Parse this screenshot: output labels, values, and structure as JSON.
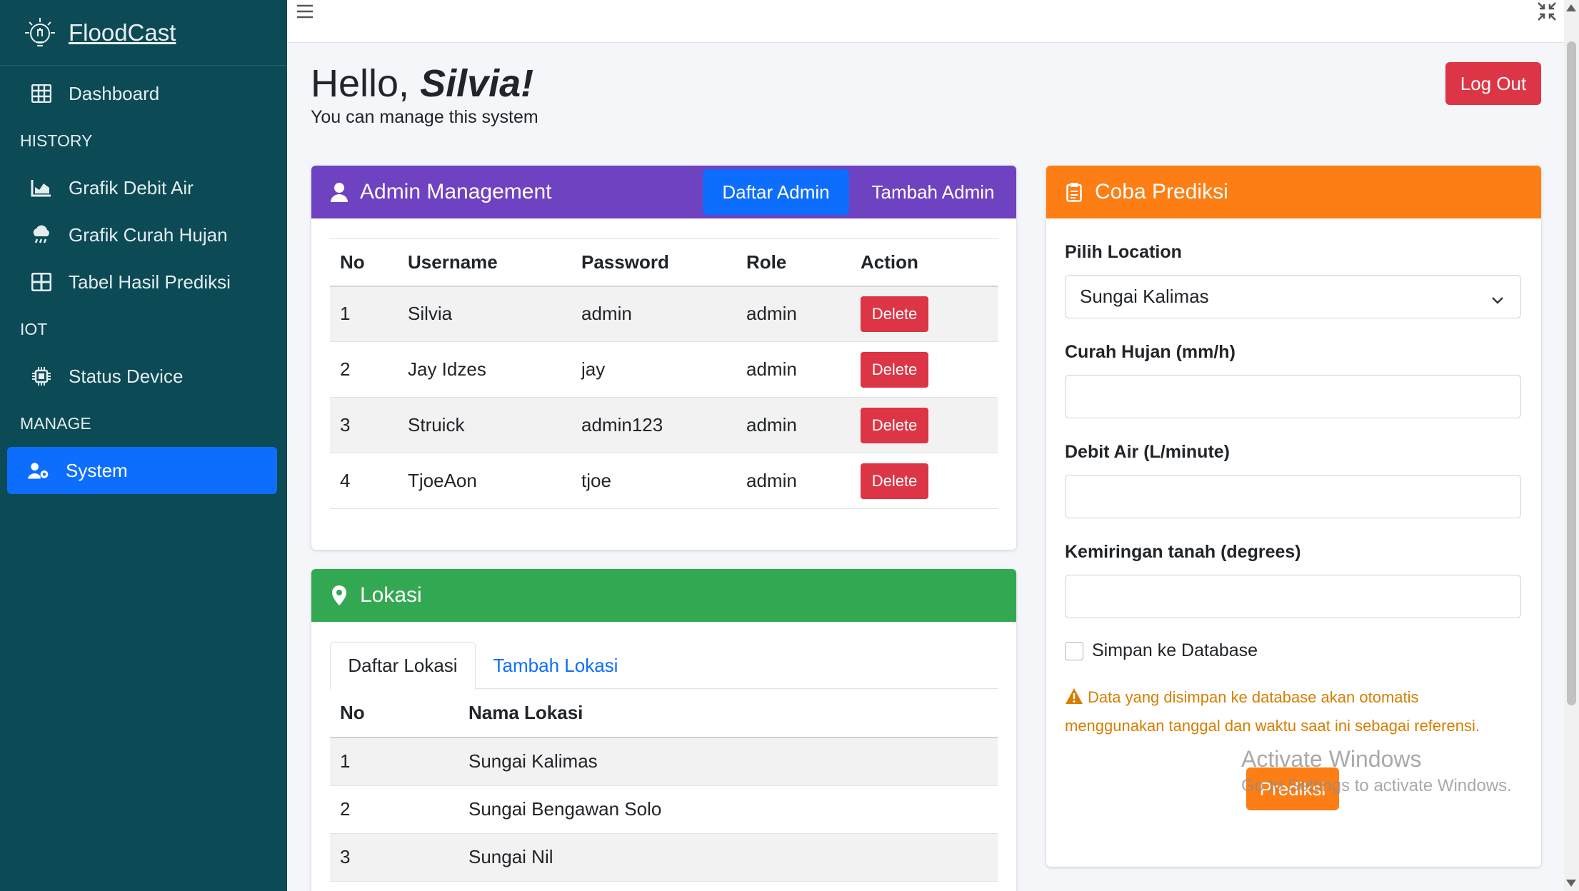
{
  "app": {
    "brand": "FloodCast"
  },
  "sidebar": {
    "items": [
      {
        "label": "Dashboard"
      },
      {
        "header": "HISTORY"
      },
      {
        "label": "Grafik Debit Air"
      },
      {
        "label": "Grafik Curah Hujan"
      },
      {
        "label": "Tabel Hasil Prediksi"
      },
      {
        "header": "IOT"
      },
      {
        "label": "Status Device"
      },
      {
        "header": "MANAGE"
      },
      {
        "label": "System"
      }
    ]
  },
  "greeting": {
    "hello": "Hello, ",
    "name": "Silvia!",
    "subtitle": "You can manage this system"
  },
  "logout_label": "Log Out",
  "admin": {
    "title": "Admin Management",
    "tab_daftar": "Daftar Admin",
    "tab_tambah": "Tambah Admin",
    "columns": [
      "No",
      "Username",
      "Password",
      "Role",
      "Action"
    ],
    "rows": [
      {
        "no": "1",
        "username": "Silvia",
        "password": "admin",
        "role": "admin",
        "action": "Delete"
      },
      {
        "no": "2",
        "username": "Jay Idzes",
        "password": "jay",
        "role": "admin",
        "action": "Delete"
      },
      {
        "no": "3",
        "username": "Struick",
        "password": "admin123",
        "role": "admin",
        "action": "Delete"
      },
      {
        "no": "4",
        "username": "TjoeAon",
        "password": "tjoe",
        "role": "admin",
        "action": "Delete"
      }
    ]
  },
  "lokasi": {
    "title": "Lokasi",
    "tab_daftar": "Daftar Lokasi",
    "tab_tambah": "Tambah Lokasi",
    "columns": [
      "No",
      "Nama Lokasi"
    ],
    "rows": [
      {
        "no": "1",
        "nama": "Sungai Kalimas"
      },
      {
        "no": "2",
        "nama": "Sungai Bengawan Solo"
      },
      {
        "no": "3",
        "nama": "Sungai Nil"
      }
    ]
  },
  "prediksi": {
    "title": "Coba Prediksi",
    "location_label": "Pilih Location",
    "location_value": "Sungai Kalimas",
    "curah_label": "Curah Hujan (mm/h)",
    "curah_value": "",
    "debit_label": "Debit Air (L/minute)",
    "debit_value": "",
    "kemiringan_label": "Kemiringan tanah (degrees)",
    "kemiringan_value": "",
    "checkbox_label": "Simpan ke Database",
    "warning": "Data yang disimpan ke database akan otomatis menggunakan tanggal dan waktu saat ini sebagai referensi.",
    "button": "Prediksi"
  },
  "watermark": {
    "line1": "Activate Windows",
    "line2": "Go to Settings to activate Windows."
  },
  "colors": {
    "sidebar": "#0c4a55",
    "active": "#0d6efd",
    "purple": "#6f42c1",
    "green": "#33a852",
    "orange": "#fd7e14",
    "danger": "#dc3545"
  }
}
